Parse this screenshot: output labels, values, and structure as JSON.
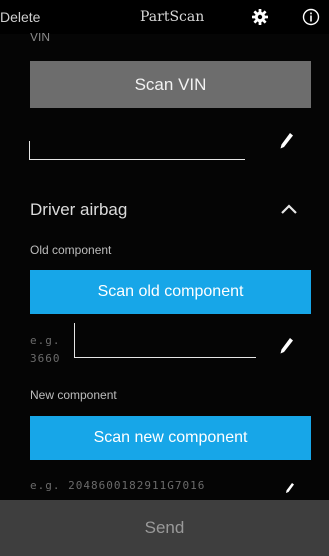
{
  "topbar": {
    "delete_label": "Delete",
    "title": "PartScan",
    "settings_icon": "gear-icon",
    "info_icon": "info-icon"
  },
  "vin": {
    "label": "VIN",
    "scan_button": "Scan VIN",
    "value": "",
    "edit_icon": "pencil-icon"
  },
  "section": {
    "title": "Driver airbag",
    "toggle_icon": "chevron-up-icon"
  },
  "old_component": {
    "label": "Old component",
    "scan_button": "Scan old component",
    "placeholder_line1": "e.g.",
    "placeholder_line2": "3660",
    "edit_icon": "pencil-icon"
  },
  "new_component": {
    "label": "New component",
    "scan_button": "Scan new component",
    "placeholder": "e.g. 2048600182911G7016",
    "edit_icon": "pencil-icon"
  },
  "footer": {
    "send_label": "Send"
  },
  "colors": {
    "background": "#050505",
    "primary_button": "#17a6e8",
    "secondary_button": "#6d6d6d",
    "send_bar": "#3e3e3e"
  }
}
